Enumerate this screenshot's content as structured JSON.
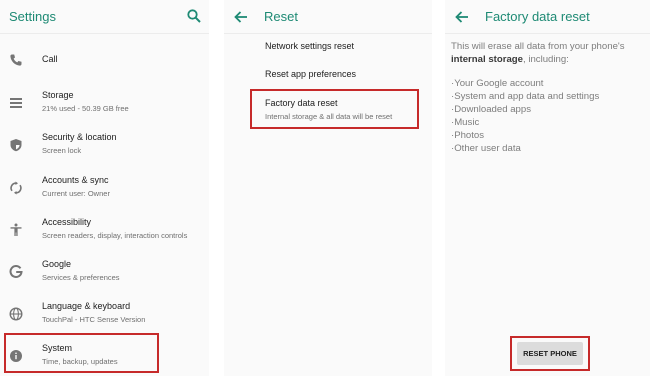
{
  "settings": {
    "title": "Settings",
    "items": [
      {
        "title": "Call",
        "subtitle": ""
      },
      {
        "title": "Storage",
        "subtitle": "21% used - 50.39 GB free"
      },
      {
        "title": "Security & location",
        "subtitle": "Screen lock"
      },
      {
        "title": "Accounts & sync",
        "subtitle": "Current user: Owner"
      },
      {
        "title": "Accessibility",
        "subtitle": "Screen readers, display, interaction controls"
      },
      {
        "title": "Google",
        "subtitle": "Services & preferences"
      },
      {
        "title": "Language & keyboard",
        "subtitle": "TouchPal - HTC Sense Version"
      },
      {
        "title": "System",
        "subtitle": "Time, backup, updates"
      }
    ]
  },
  "reset": {
    "title": "Reset",
    "items": [
      {
        "title": "Network settings reset"
      },
      {
        "title": "Reset app preferences"
      },
      {
        "title": "Factory data reset",
        "subtitle": "Internal storage & all data will be reset"
      }
    ]
  },
  "factory": {
    "title": "Factory data reset",
    "intro_prefix": "This will erase all data from your phone's",
    "intro_bold": "internal storage",
    "intro_suffix": ", including:",
    "items": [
      "·Your Google account",
      "·System and app data and settings",
      "·Downloaded apps",
      "·Music",
      "·Photos",
      "·Other user data"
    ],
    "button_label": "RESET PHONE"
  },
  "colors": {
    "accent": "#1e8a74",
    "highlight": "#c62a2a"
  }
}
